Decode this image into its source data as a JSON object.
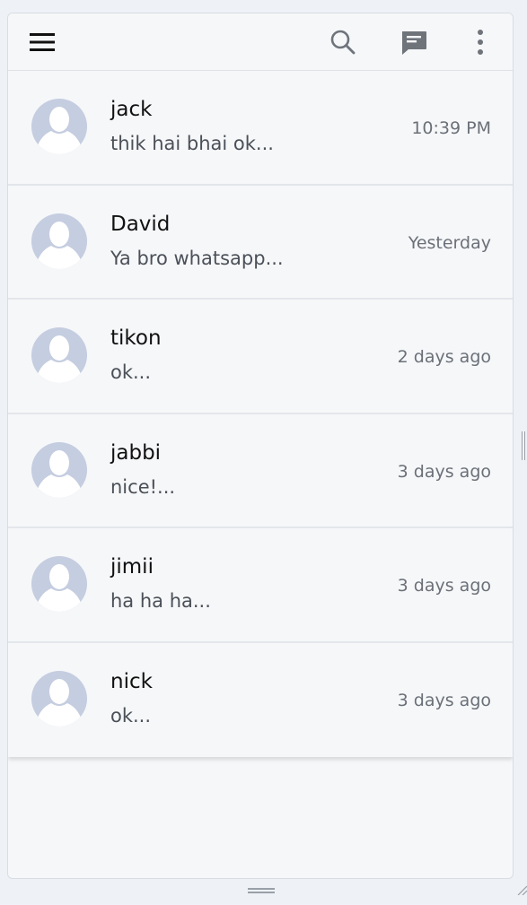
{
  "toolbar": {
    "icons": [
      "menu-icon",
      "search-icon",
      "new-chat-icon",
      "more-vert-icon"
    ]
  },
  "colors": {
    "background": "#f6f7f9",
    "avatar_bg": "#c5cde0",
    "avatar_silhouette": "#ffffff",
    "name_text": "#111111",
    "preview_text": "#4b5058",
    "time_text": "#6b7078",
    "icon_gray": "#6f747b"
  },
  "chats": [
    {
      "name": "jack",
      "preview": "thik hai bhai ok...",
      "time": "10:39 PM"
    },
    {
      "name": "David",
      "preview": "Ya bro whatsapp...",
      "time": "Yesterday"
    },
    {
      "name": "tikon",
      "preview": "ok...",
      "time": "2 days ago"
    },
    {
      "name": "jabbi",
      "preview": "nice!...",
      "time": "3 days ago"
    },
    {
      "name": "jimii",
      "preview": "ha ha ha...",
      "time": "3 days ago"
    },
    {
      "name": "nick",
      "preview": "ok...",
      "time": "3 days ago"
    }
  ]
}
